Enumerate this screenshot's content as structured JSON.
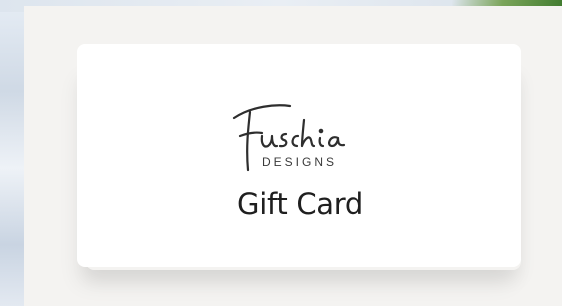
{
  "card": {
    "brand_script": "Fuschia",
    "brand_sub": "DESIGNS",
    "title": "Gift Card"
  },
  "colors": {
    "panel_bg": "#f4f3f1",
    "card_bg": "#ffffff",
    "text": "#1f1f1f",
    "leaf_green": "#3f7a2e"
  },
  "icons": {
    "logo": "fuschia-designs-logo"
  }
}
